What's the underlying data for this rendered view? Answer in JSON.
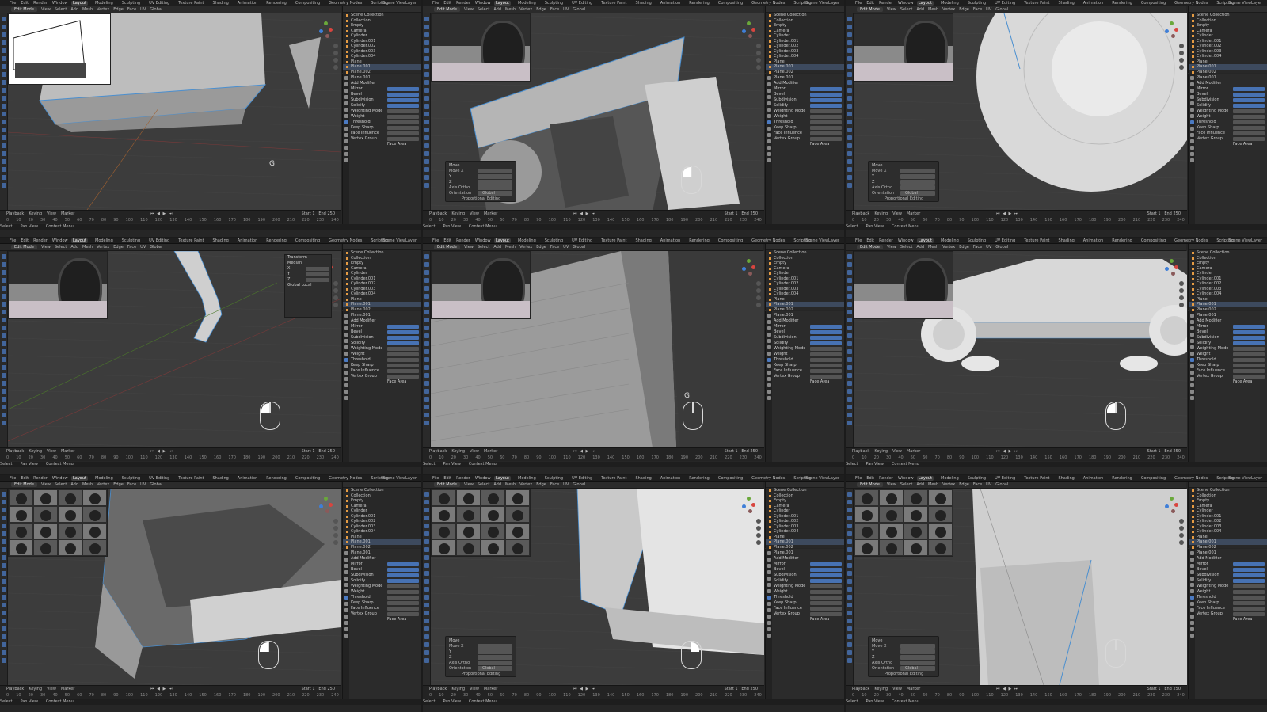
{
  "app": {
    "menu": [
      "File",
      "Edit",
      "Render",
      "Window",
      "Help"
    ],
    "workspaces": [
      "Layout",
      "Modeling",
      "Sculpting",
      "UV Editing",
      "Texture Paint",
      "Shading",
      "Animation",
      "Rendering",
      "Compositing",
      "Geometry Nodes",
      "Scripting"
    ],
    "active_workspace": "Layout",
    "scene": "Scene",
    "view_layer": "ViewLayer"
  },
  "header": {
    "mode": "Edit Mode",
    "items": [
      "View",
      "Select",
      "Add",
      "Mesh",
      "Vertex",
      "Edge",
      "Face",
      "UV"
    ],
    "transform": "Global"
  },
  "timeline": {
    "items": [
      "Playback",
      "Keying",
      "View",
      "Marker"
    ],
    "start_label": "Start",
    "start": "1",
    "end_label": "End",
    "end": "250",
    "frames": [
      "0",
      "10",
      "20",
      "30",
      "40",
      "50",
      "60",
      "70",
      "80",
      "90",
      "100",
      "110",
      "120",
      "130",
      "140",
      "150",
      "160",
      "170",
      "180",
      "190",
      "200",
      "210",
      "220",
      "230",
      "240",
      "250"
    ]
  },
  "status": {
    "items": [
      "Select",
      "Pan View",
      "Context Menu"
    ]
  },
  "outliner": {
    "title": "Scene Collection",
    "items": [
      "Collection",
      "Empty",
      "Camera",
      "Cylinder",
      "Cylinder.001",
      "Cylinder.002",
      "Cylinder.003",
      "Cylinder.004",
      "Plane",
      "Plane.001",
      "Plane.002"
    ]
  },
  "properties": {
    "object": "Plane.001",
    "modifier_label": "Add Modifier",
    "rows": [
      "Mirror",
      "Bevel",
      "Subdivision",
      "Solidify",
      "Weighting Mode",
      "Weight",
      "Threshold",
      "Keep Sharp",
      "Face Influence",
      "Vertex Group"
    ],
    "weighting_value": "Face Area"
  },
  "operator_panel": {
    "title": "Move",
    "rows": [
      "Move X",
      "Y",
      "Z",
      "Axis Ortho",
      "Orientation"
    ],
    "orientation": "Global",
    "proportional": "Proportional Editing"
  },
  "key_hint": "G",
  "transform_panel": {
    "title": "Transform",
    "median": "Median",
    "rows": [
      "X",
      "Y",
      "Z"
    ],
    "space": "Global",
    "local": "Local"
  }
}
